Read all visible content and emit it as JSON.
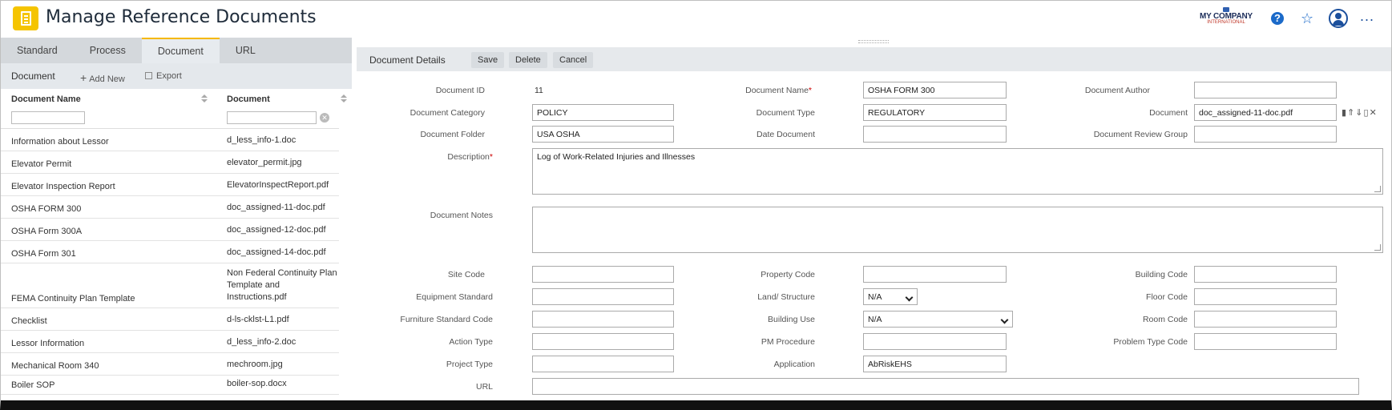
{
  "header": {
    "title": "Manage Reference Documents",
    "logo_main": "MY COMPANY",
    "logo_sub": "INTERNATIONAL",
    "help_label": "?",
    "more_label": "..."
  },
  "tabs": [
    {
      "label": "Standard"
    },
    {
      "label": "Process"
    },
    {
      "label": "Document"
    },
    {
      "label": "URL"
    }
  ],
  "list": {
    "title": "Document",
    "add_new": "Add New",
    "export": "Export",
    "col1": "Document Name",
    "col2": "Document",
    "rows": [
      {
        "name": "Information about Lessor",
        "doc": "d_less_info-1.doc"
      },
      {
        "name": "Elevator Permit",
        "doc": "elevator_permit.jpg"
      },
      {
        "name": "Elevator Inspection Report",
        "doc": "ElevatorInspectReport.pdf"
      },
      {
        "name": "OSHA FORM 300",
        "doc": "doc_assigned-11-doc.pdf"
      },
      {
        "name": "OSHA Form 300A",
        "doc": "doc_assigned-12-doc.pdf"
      },
      {
        "name": "OSHA Form 301",
        "doc": "doc_assigned-14-doc.pdf"
      },
      {
        "name": "FEMA Continuity Plan Template",
        "doc": "Non Federal Continuity Plan Template and Instructions.pdf"
      },
      {
        "name": "Checklist",
        "doc": "d-ls-cklst-L1.pdf"
      },
      {
        "name": "Lessor Information",
        "doc": "d_less_info-2.doc"
      },
      {
        "name": "Mechanical Room 340",
        "doc": "mechroom.jpg"
      },
      {
        "name": "Boiler SOP",
        "doc": "boiler-sop.docx"
      }
    ]
  },
  "details": {
    "title": "Document Details",
    "save": "Save",
    "delete": "Delete",
    "cancel": "Cancel",
    "labels": {
      "doc_id": "Document ID",
      "doc_name": "Document Name",
      "doc_author": "Document Author",
      "doc_category": "Document Category",
      "doc_type": "Document Type",
      "document": "Document",
      "doc_folder": "Document Folder",
      "date_doc": "Date Document",
      "review_group": "Document Review Group",
      "description": "Description",
      "notes": "Document Notes",
      "site_code": "Site Code",
      "property_code": "Property Code",
      "building_code": "Building Code",
      "equipment_standard": "Equipment Standard",
      "land_structure": "Land/ Structure",
      "floor_code": "Floor Code",
      "furniture_standard": "Furniture Standard Code",
      "building_use": "Building Use",
      "room_code": "Room Code",
      "action_type": "Action Type",
      "pm_procedure": "PM Procedure",
      "problem_type": "Problem Type Code",
      "project_type": "Project Type",
      "application": "Application",
      "url": "URL"
    },
    "values": {
      "doc_id": "11",
      "doc_name": "OSHA FORM 300",
      "doc_author": "",
      "doc_category": "POLICY",
      "doc_type": "REGULATORY",
      "document": "doc_assigned-11-doc.pdf",
      "doc_folder": "USA OSHA",
      "date_doc": "",
      "review_group": "",
      "description": "Log of Work-Related Injuries and Illnesses",
      "notes": "",
      "land_structure": "N/A",
      "building_use": "N/A",
      "application": "AbRiskEHS"
    }
  }
}
